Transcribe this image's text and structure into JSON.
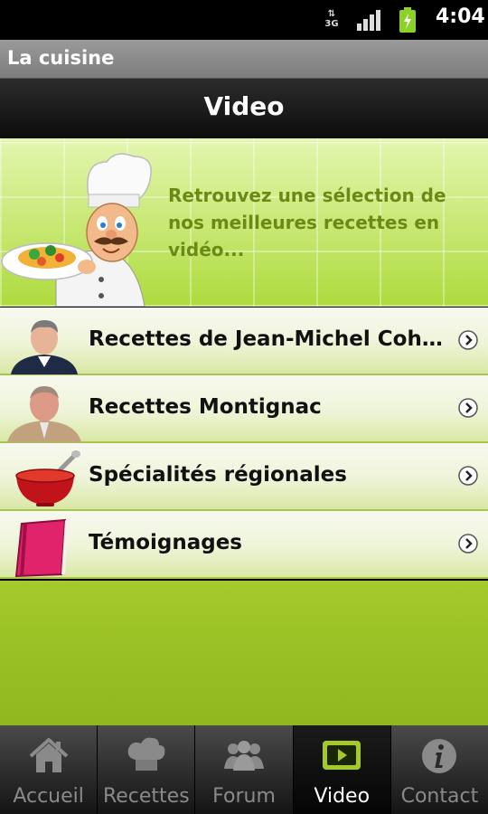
{
  "status_bar": {
    "network": "3G",
    "time": "4:04",
    "icons": [
      "data-arrows-icon",
      "signal-icon",
      "battery-icon"
    ]
  },
  "app": {
    "title": "La cuisine"
  },
  "page": {
    "heading": "Video"
  },
  "banner": {
    "text": "Retrouvez une sélection de nos meilleures recettes en vidéo...",
    "icon": "chef-icon"
  },
  "list": {
    "items": [
      {
        "label": "Recettes de Jean-Michel Coh…",
        "thumb": "person-portrait-1"
      },
      {
        "label": "Recettes Montignac",
        "thumb": "person-portrait-2"
      },
      {
        "label": "Spécialités régionales",
        "thumb": "soup-bowl-icon"
      },
      {
        "label": "Témoignages",
        "thumb": "book-icon"
      }
    ]
  },
  "tabs": {
    "items": [
      {
        "label": "Accueil",
        "icon": "home-icon",
        "active": false
      },
      {
        "label": "Recettes",
        "icon": "chef-hat-icon",
        "active": false
      },
      {
        "label": "Forum",
        "icon": "people-icon",
        "active": false
      },
      {
        "label": "Video",
        "icon": "video-icon",
        "active": true
      },
      {
        "label": "Contact",
        "icon": "info-icon",
        "active": false
      }
    ]
  },
  "colors": {
    "accent_green": "#a4ca2a",
    "banner_text": "#6b8a14",
    "row_border": "#a7c64a"
  }
}
